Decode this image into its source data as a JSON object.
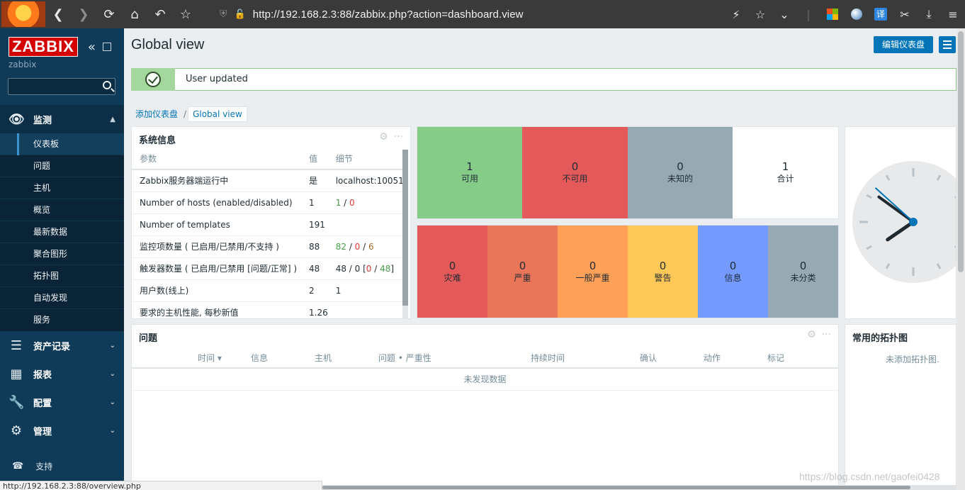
{
  "browser": {
    "url": "http://192.168.2.3:88/zabbix.php?action=dashboard.view",
    "status_url": "http://192.168.2.3:88/overview.php",
    "translate_label": "译"
  },
  "sidebar": {
    "logo": "ZABBIX",
    "server_name": "zabbix",
    "search_placeholder": "",
    "monitoring": {
      "label": "监测",
      "items": [
        "仪表板",
        "问题",
        "主机",
        "概览",
        "最新数据",
        "聚合图形",
        "拓扑图",
        "自动发现",
        "服务"
      ]
    },
    "sections": [
      "资产记录",
      "报表",
      "配置",
      "管理"
    ],
    "support": "支持"
  },
  "main": {
    "title": "Global view",
    "edit_button": "编辑仪表盘",
    "message": "User updated",
    "breadcrumb": {
      "link": "添加仪表盘",
      "current": "Global view"
    }
  },
  "system_info": {
    "title": "系统信息",
    "headers": [
      "参数",
      "值",
      "细节"
    ],
    "rows": [
      {
        "param": "Zabbix服务器端运行中",
        "value": "是",
        "detail": "localhost:10051"
      },
      {
        "param": "Number of hosts (enabled/disabled)",
        "value": "1",
        "detail_a": "1",
        "detail_b": "0"
      },
      {
        "param": "Number of templates",
        "value": "191"
      },
      {
        "param": "监控项数量 ( 已启用/已禁用/不支持 )",
        "value": "88",
        "detail_a": "82",
        "detail_b": "0",
        "detail_c": "6"
      },
      {
        "param": "触发器数量 ( 已启用/已禁用 [问题/正常] )",
        "value": "48",
        "detail_pre": "48 / 0 [",
        "detail_a": "0",
        "detail_b": "48",
        "detail_post": "]"
      },
      {
        "param": "用户数(线上)",
        "value": "2",
        "detail_a": "1"
      },
      {
        "param": "要求的主机性能, 每秒新值",
        "value": "1.26"
      }
    ]
  },
  "host_availability": [
    {
      "count": "1",
      "label": "可用",
      "color": "#86cc89"
    },
    {
      "count": "0",
      "label": "不可用",
      "color": "#e45959"
    },
    {
      "count": "0",
      "label": "未知的",
      "color": "#97aab3"
    },
    {
      "count": "1",
      "label": "合计",
      "color": "#ffffff"
    }
  ],
  "problems_by_severity": [
    {
      "count": "0",
      "label": "灾难",
      "color": "#e45959"
    },
    {
      "count": "0",
      "label": "严重",
      "color": "#e97659"
    },
    {
      "count": "0",
      "label": "一般严重",
      "color": "#ffa059"
    },
    {
      "count": "0",
      "label": "警告",
      "color": "#ffc859"
    },
    {
      "count": "0",
      "label": "信息",
      "color": "#7499ff"
    },
    {
      "count": "0",
      "label": "未分类",
      "color": "#97aab3"
    }
  ],
  "clock": {
    "hour": 7,
    "minute": 51
  },
  "problems": {
    "title": "问题",
    "headers": [
      "时间 ▾",
      "信息",
      "主机",
      "问题 • 严重性",
      "持续时间",
      "确认",
      "动作",
      "标记"
    ],
    "empty": "未发现数据"
  },
  "maps": {
    "title": "常用的拓扑图",
    "empty": "未添加拓扑图."
  },
  "watermark": "https://blog.csdn.net/gaofei0428"
}
